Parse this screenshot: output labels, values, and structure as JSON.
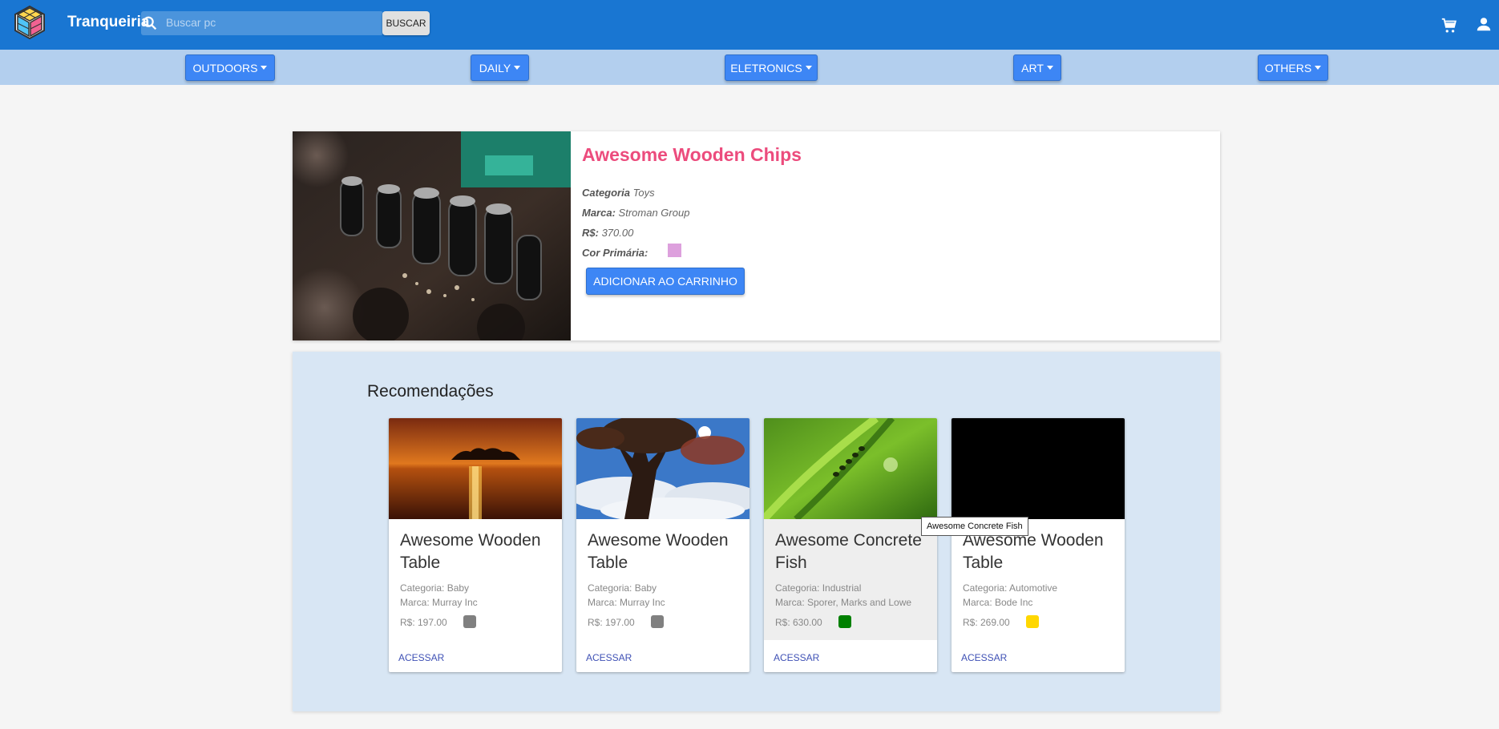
{
  "header": {
    "brand": "Tranqueiria",
    "search_placeholder": "Buscar pc",
    "search_button": "BUSCAR",
    "icons": [
      "logo-cube-icon",
      "search-icon",
      "cart-icon",
      "user-icon"
    ]
  },
  "categories": [
    {
      "label": "OUTDOORS"
    },
    {
      "label": "DAILY"
    },
    {
      "label": "ELETRONICS"
    },
    {
      "label": "ART"
    },
    {
      "label": "OTHERS"
    }
  ],
  "product": {
    "title": "Awesome Wooden Chips",
    "category_label": "Categoria",
    "category_value": "Toys",
    "brand_label": "Marca:",
    "brand_value": "Stroman Group",
    "price_label": "R$:",
    "price_value": "370.00",
    "color_label": "Cor Primária:",
    "primary_color": "#dda0dd",
    "add_to_cart": "ADICIONAR AO CARRINHO"
  },
  "recommendations": {
    "title": "Recomendações",
    "items": [
      {
        "name": "Awesome Wooden Table",
        "category": "Categoria: Baby",
        "brand": "Marca: Murray Inc",
        "price": "R$: 197.00",
        "color": "#808080",
        "action": "ACESSAR",
        "image": "sunset-lake"
      },
      {
        "name": "Awesome Wooden Table",
        "category": "Categoria: Baby",
        "brand": "Marca: Murray Inc",
        "price": "R$: 197.00",
        "color": "#808080",
        "action": "ACESSAR",
        "image": "tree-sky"
      },
      {
        "name": "Awesome Concrete Fish",
        "category": "Categoria: Industrial",
        "brand": "Marca: Sporer, Marks and Lowe",
        "price": "R$: 630.00",
        "color": "#008000",
        "action": "ACESSAR",
        "image": "green-grass"
      },
      {
        "name": "Awesome Wooden Table",
        "category": "Categoria: Automotive",
        "brand": "Marca: Bode Inc",
        "price": "R$: 269.00",
        "color": "#ffd700",
        "action": "ACESSAR",
        "image": "black"
      }
    ]
  },
  "tooltip": "Awesome Concrete Fish",
  "colors": {
    "appbar": "#1976d2",
    "catbar": "#b3cfee",
    "accent_button": "#3d86f5",
    "product_title": "#ec4c7d",
    "recs_bg": "#d8e6f4",
    "link": "#3f51b5"
  }
}
